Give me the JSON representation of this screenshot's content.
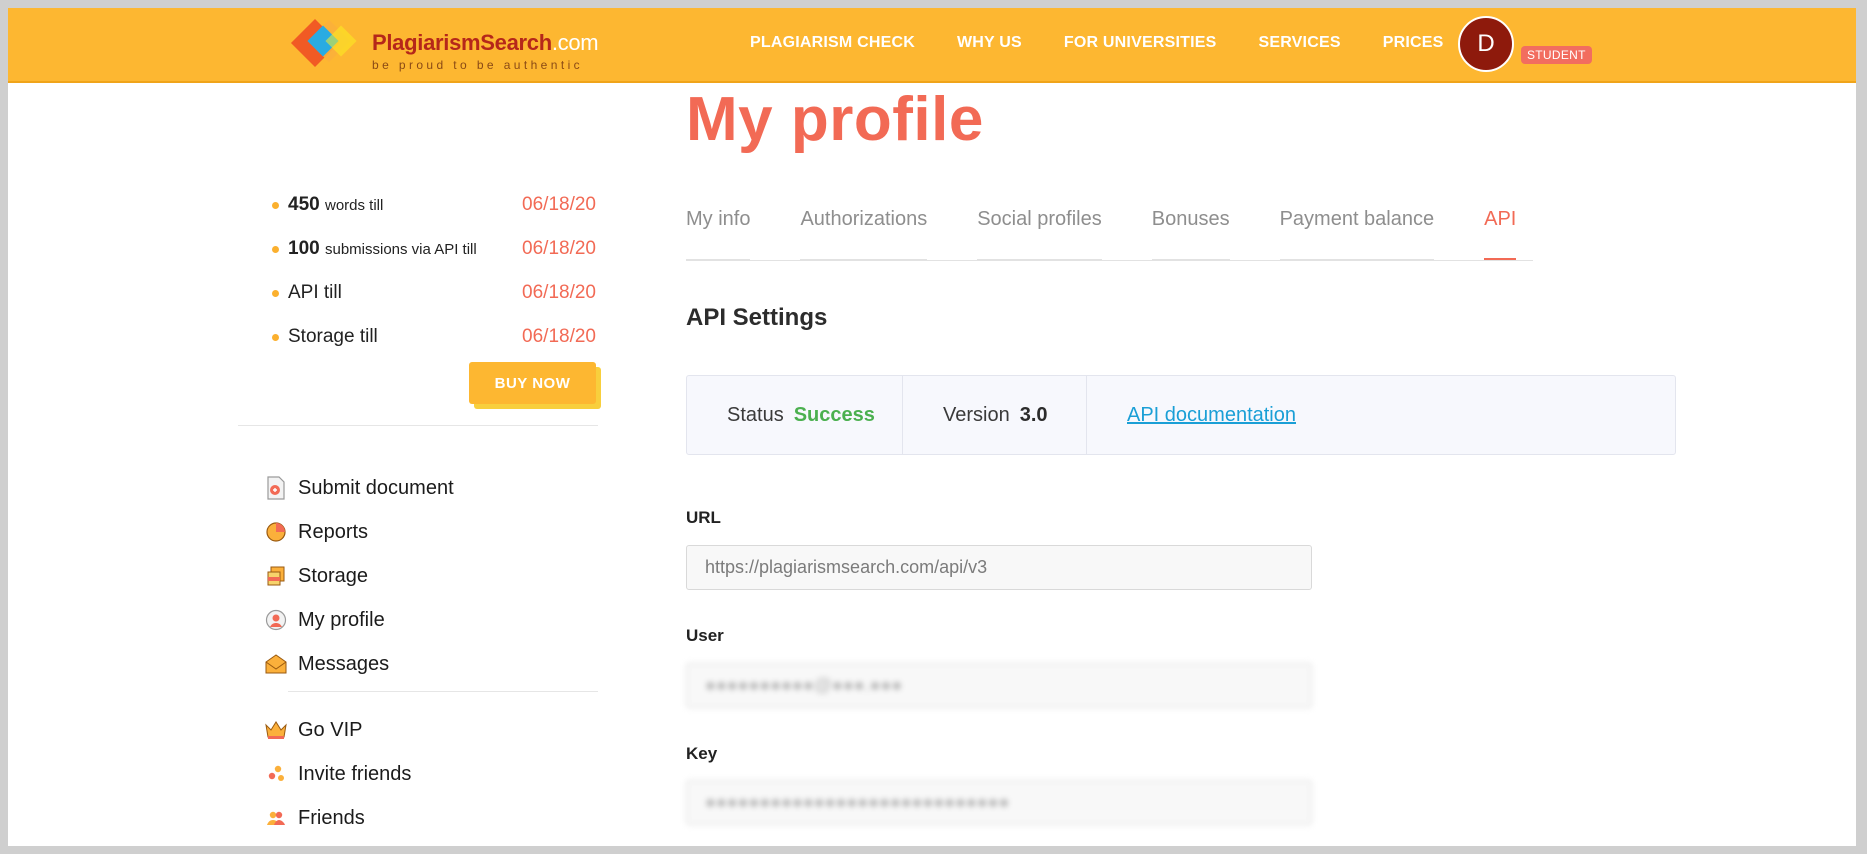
{
  "header": {
    "logo_name": "PlagiarismSearch",
    "logo_domain": ".com",
    "logo_tagline": "be proud to be authentic",
    "nav": [
      "PLAGIARISM CHECK",
      "WHY US",
      "FOR UNIVERSITIES",
      "SERVICES",
      "PRICES"
    ],
    "avatar_letter": "D",
    "role_badge": "STUDENT"
  },
  "page": {
    "title": "My profile"
  },
  "sidebar": {
    "limits": [
      {
        "amount": "450",
        "text": "words till",
        "date": "06/18/20"
      },
      {
        "amount": "100",
        "text": "submissions via API till",
        "date": "06/18/20"
      },
      {
        "amount": "",
        "text": "API till",
        "date": "06/18/20"
      },
      {
        "amount": "",
        "text": "Storage till",
        "date": "06/18/20"
      }
    ],
    "buy_label": "BUY NOW",
    "menu": [
      {
        "label": "Submit document",
        "icon": "document-icon"
      },
      {
        "label": "Reports",
        "icon": "pie-chart-icon"
      },
      {
        "label": "Storage",
        "icon": "storage-icon"
      },
      {
        "label": "My profile",
        "icon": "user-icon"
      },
      {
        "label": "Messages",
        "icon": "envelope-icon"
      }
    ],
    "menu2": [
      {
        "label": "Go VIP",
        "icon": "crown-icon"
      },
      {
        "label": "Invite friends",
        "icon": "invite-icon"
      },
      {
        "label": "Friends",
        "icon": "friends-icon"
      }
    ]
  },
  "tabs": [
    {
      "label": "My info",
      "active": false
    },
    {
      "label": "Authorizations",
      "active": false
    },
    {
      "label": "Social profiles",
      "active": false
    },
    {
      "label": "Bonuses",
      "active": false
    },
    {
      "label": "Payment balance",
      "active": false
    },
    {
      "label": "API",
      "active": true
    }
  ],
  "api": {
    "section_title": "API Settings",
    "status_label": "Status",
    "status_value": "Success",
    "version_label": "Version",
    "version_value": "3.0",
    "doc_link": "API documentation",
    "url_label": "URL",
    "url_value": "https://plagiarismsearch.com/api/v3",
    "user_label": "User",
    "user_value": "●●●●●●●●●●@●●●.●●●",
    "key_label": "Key",
    "key_value": "●●●●●●●●●●●●●●●●●●●●●●●●●●●●"
  },
  "colors": {
    "brand_yellow": "#fdb731",
    "accent_red": "#f26a55",
    "success_green": "#4bb04f",
    "link_blue": "#1a9fd6"
  }
}
